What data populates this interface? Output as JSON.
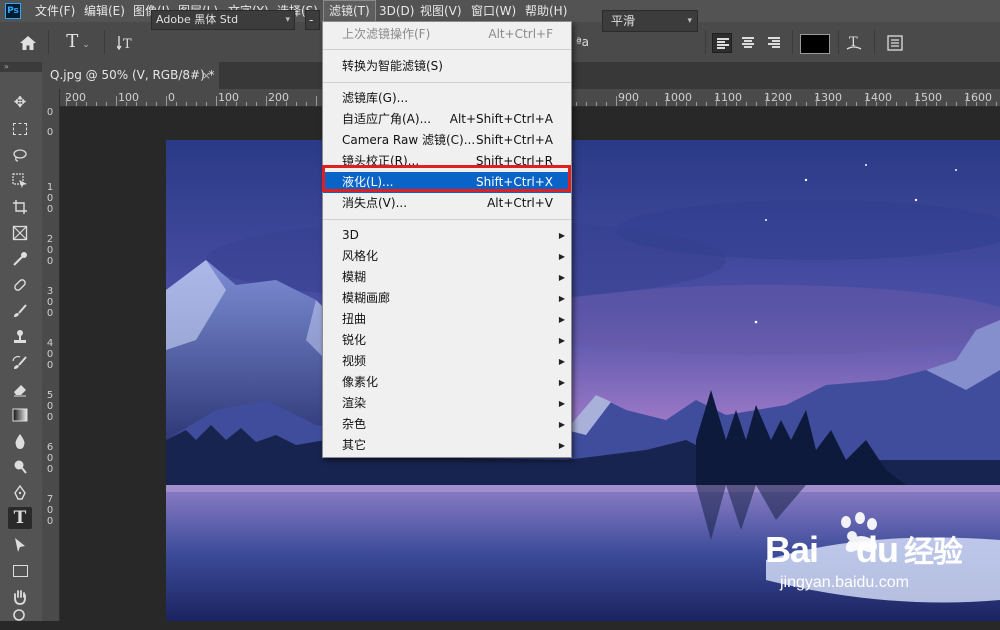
{
  "menubar": {
    "app_logo": "Ps",
    "items": [
      "文件(F)",
      "编辑(E)",
      "图像(I)",
      "图层(L)",
      "文字(Y)",
      "选择(S)",
      "滤镜(T)",
      "3D(D)",
      "视图(V)",
      "窗口(W)",
      "帮助(H)"
    ],
    "active": "滤镜(T)"
  },
  "options_bar": {
    "font_family": "Adobe 黑体 Std",
    "font_style": "-",
    "aa_icon": "ªa",
    "antialias": "平滑"
  },
  "tab": {
    "title": "Q.jpg @ 50% (V, RGB/8#) *",
    "close": "×"
  },
  "toolbar": {
    "collapse": "»"
  },
  "ruler": {
    "h_labels": [
      "200",
      "100",
      "0",
      "100",
      "200",
      "900",
      "1000",
      "1100",
      "1200",
      "1300",
      "1400",
      "1500",
      "1600"
    ],
    "v_labels": [
      "0",
      "0",
      "1 0 0",
      "2 0 0",
      "3 0 0",
      "4 0 0",
      "5 0 0",
      "6 0 0",
      "7 0 0"
    ]
  },
  "filter_menu": {
    "items": [
      {
        "label": "上次滤镜操作(F)",
        "shortcut": "Alt+Ctrl+F",
        "disabled": true
      },
      {
        "label": "转换为智能滤镜(S)",
        "shortcut": ""
      },
      {
        "label": "滤镜库(G)...",
        "shortcut": ""
      },
      {
        "label": "自适应广角(A)...",
        "shortcut": "Alt+Shift+Ctrl+A"
      },
      {
        "label": "Camera Raw 滤镜(C)...",
        "shortcut": "Shift+Ctrl+A"
      },
      {
        "label": "镜头校正(R)...",
        "shortcut": "Shift+Ctrl+R"
      },
      {
        "label": "液化(L)...",
        "shortcut": "Shift+Ctrl+X",
        "highlighted": true
      },
      {
        "label": "消失点(V)...",
        "shortcut": "Alt+Ctrl+V"
      },
      {
        "label": "3D",
        "submenu": true
      },
      {
        "label": "风格化",
        "submenu": true
      },
      {
        "label": "模糊",
        "submenu": true
      },
      {
        "label": "模糊画廊",
        "submenu": true
      },
      {
        "label": "扭曲",
        "submenu": true
      },
      {
        "label": "锐化",
        "submenu": true
      },
      {
        "label": "视频",
        "submenu": true
      },
      {
        "label": "像素化",
        "submenu": true
      },
      {
        "label": "渲染",
        "submenu": true
      },
      {
        "label": "杂色",
        "submenu": true
      },
      {
        "label": "其它",
        "submenu": true
      }
    ]
  },
  "watermark": {
    "brand": "Bai",
    "brand2": "du",
    "site_cn": "经验",
    "url": "jingyan.baidu.com"
  },
  "colors": {
    "menu_highlight": "#0a64c8",
    "callout_border": "#e02020",
    "foreground_color": "#000000"
  }
}
